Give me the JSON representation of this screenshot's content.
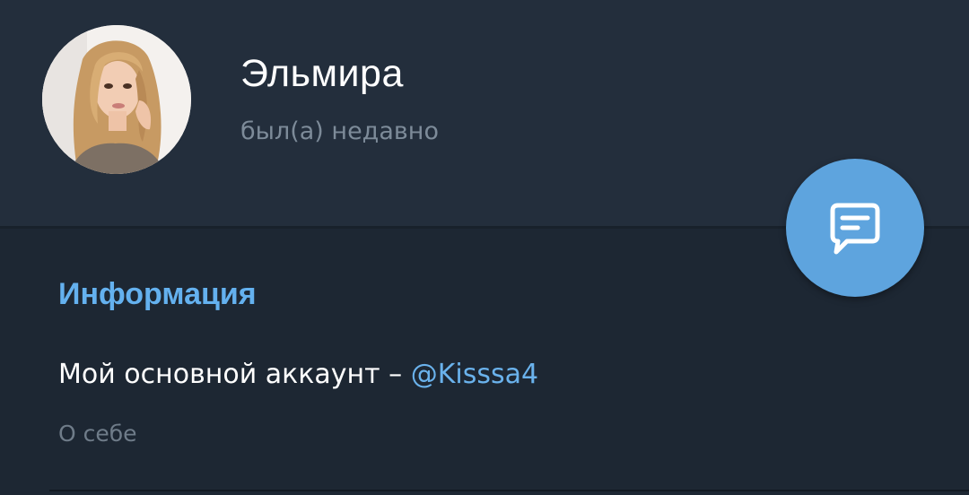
{
  "profile": {
    "name": "Эльмира",
    "status": "был(а) недавно",
    "avatar_icon": "profile-photo"
  },
  "fab": {
    "icon": "message-icon",
    "color": "#5ea4de"
  },
  "info": {
    "title": "Информация",
    "bio_text": "Мой основной аккаунт – ",
    "bio_link": "@Kisssa4",
    "bio_caption": "О себе"
  },
  "colors": {
    "header_bg": "#232e3c",
    "body_bg": "#1d2733",
    "accent": "#64b1ef",
    "link": "#6ab2ec",
    "muted": "#7d8b99"
  }
}
